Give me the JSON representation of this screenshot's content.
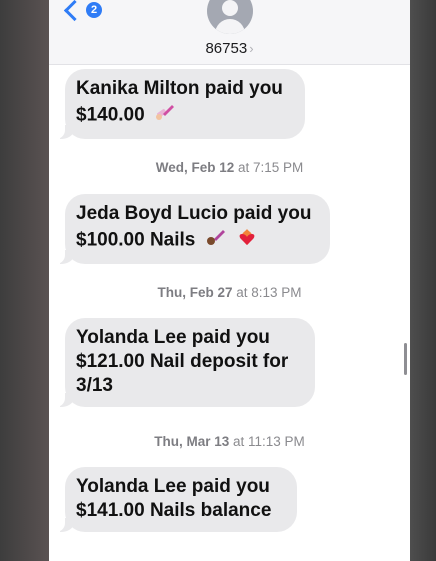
{
  "header": {
    "back_badge": "2",
    "contact_name": "86753",
    "contact_chevron": "›"
  },
  "messages": [
    {
      "text_line1": "Kanika Milton paid you",
      "text_line2": "$140.00",
      "emoji": "nail-polish"
    },
    {
      "timestamp_day": "Wed, Feb 12",
      "timestamp_time": "at 7:15 PM"
    },
    {
      "text_line1": "Jeda Boyd Lucio paid you",
      "text_line2": "$100.00 Nails",
      "emoji": "nail-polish-dark heart-on-fire"
    },
    {
      "timestamp_day": "Thu, Feb 27",
      "timestamp_time": "at 8:13 PM"
    },
    {
      "text_line1": "Yolanda Lee paid you",
      "text_line2": "$121.00 Nail deposit for",
      "text_line3": "3/13"
    },
    {
      "timestamp_day": "Thu, Mar 13",
      "timestamp_time": "at 11:13 PM"
    },
    {
      "text_line1": "Yolanda Lee paid you",
      "text_line2": "$141.00 Nails balance"
    }
  ],
  "colors": {
    "accent": "#2f7cf6",
    "bubble_bg": "#e9e9eb",
    "timestamp": "#8a8a8e"
  }
}
